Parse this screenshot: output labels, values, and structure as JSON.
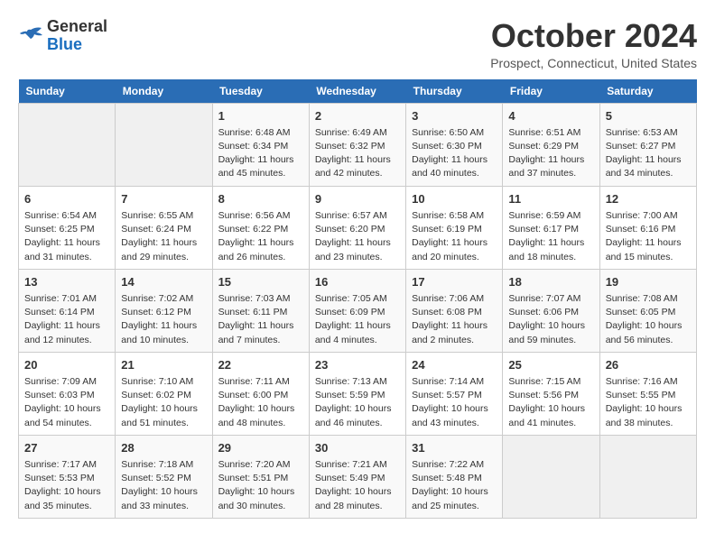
{
  "header": {
    "logo_line1": "General",
    "logo_line2": "Blue",
    "month": "October 2024",
    "location": "Prospect, Connecticut, United States"
  },
  "weekdays": [
    "Sunday",
    "Monday",
    "Tuesday",
    "Wednesday",
    "Thursday",
    "Friday",
    "Saturday"
  ],
  "weeks": [
    [
      {
        "num": "",
        "info": ""
      },
      {
        "num": "",
        "info": ""
      },
      {
        "num": "1",
        "info": "Sunrise: 6:48 AM\nSunset: 6:34 PM\nDaylight: 11 hours and 45 minutes."
      },
      {
        "num": "2",
        "info": "Sunrise: 6:49 AM\nSunset: 6:32 PM\nDaylight: 11 hours and 42 minutes."
      },
      {
        "num": "3",
        "info": "Sunrise: 6:50 AM\nSunset: 6:30 PM\nDaylight: 11 hours and 40 minutes."
      },
      {
        "num": "4",
        "info": "Sunrise: 6:51 AM\nSunset: 6:29 PM\nDaylight: 11 hours and 37 minutes."
      },
      {
        "num": "5",
        "info": "Sunrise: 6:53 AM\nSunset: 6:27 PM\nDaylight: 11 hours and 34 minutes."
      }
    ],
    [
      {
        "num": "6",
        "info": "Sunrise: 6:54 AM\nSunset: 6:25 PM\nDaylight: 11 hours and 31 minutes."
      },
      {
        "num": "7",
        "info": "Sunrise: 6:55 AM\nSunset: 6:24 PM\nDaylight: 11 hours and 29 minutes."
      },
      {
        "num": "8",
        "info": "Sunrise: 6:56 AM\nSunset: 6:22 PM\nDaylight: 11 hours and 26 minutes."
      },
      {
        "num": "9",
        "info": "Sunrise: 6:57 AM\nSunset: 6:20 PM\nDaylight: 11 hours and 23 minutes."
      },
      {
        "num": "10",
        "info": "Sunrise: 6:58 AM\nSunset: 6:19 PM\nDaylight: 11 hours and 20 minutes."
      },
      {
        "num": "11",
        "info": "Sunrise: 6:59 AM\nSunset: 6:17 PM\nDaylight: 11 hours and 18 minutes."
      },
      {
        "num": "12",
        "info": "Sunrise: 7:00 AM\nSunset: 6:16 PM\nDaylight: 11 hours and 15 minutes."
      }
    ],
    [
      {
        "num": "13",
        "info": "Sunrise: 7:01 AM\nSunset: 6:14 PM\nDaylight: 11 hours and 12 minutes."
      },
      {
        "num": "14",
        "info": "Sunrise: 7:02 AM\nSunset: 6:12 PM\nDaylight: 11 hours and 10 minutes."
      },
      {
        "num": "15",
        "info": "Sunrise: 7:03 AM\nSunset: 6:11 PM\nDaylight: 11 hours and 7 minutes."
      },
      {
        "num": "16",
        "info": "Sunrise: 7:05 AM\nSunset: 6:09 PM\nDaylight: 11 hours and 4 minutes."
      },
      {
        "num": "17",
        "info": "Sunrise: 7:06 AM\nSunset: 6:08 PM\nDaylight: 11 hours and 2 minutes."
      },
      {
        "num": "18",
        "info": "Sunrise: 7:07 AM\nSunset: 6:06 PM\nDaylight: 10 hours and 59 minutes."
      },
      {
        "num": "19",
        "info": "Sunrise: 7:08 AM\nSunset: 6:05 PM\nDaylight: 10 hours and 56 minutes."
      }
    ],
    [
      {
        "num": "20",
        "info": "Sunrise: 7:09 AM\nSunset: 6:03 PM\nDaylight: 10 hours and 54 minutes."
      },
      {
        "num": "21",
        "info": "Sunrise: 7:10 AM\nSunset: 6:02 PM\nDaylight: 10 hours and 51 minutes."
      },
      {
        "num": "22",
        "info": "Sunrise: 7:11 AM\nSunset: 6:00 PM\nDaylight: 10 hours and 48 minutes."
      },
      {
        "num": "23",
        "info": "Sunrise: 7:13 AM\nSunset: 5:59 PM\nDaylight: 10 hours and 46 minutes."
      },
      {
        "num": "24",
        "info": "Sunrise: 7:14 AM\nSunset: 5:57 PM\nDaylight: 10 hours and 43 minutes."
      },
      {
        "num": "25",
        "info": "Sunrise: 7:15 AM\nSunset: 5:56 PM\nDaylight: 10 hours and 41 minutes."
      },
      {
        "num": "26",
        "info": "Sunrise: 7:16 AM\nSunset: 5:55 PM\nDaylight: 10 hours and 38 minutes."
      }
    ],
    [
      {
        "num": "27",
        "info": "Sunrise: 7:17 AM\nSunset: 5:53 PM\nDaylight: 10 hours and 35 minutes."
      },
      {
        "num": "28",
        "info": "Sunrise: 7:18 AM\nSunset: 5:52 PM\nDaylight: 10 hours and 33 minutes."
      },
      {
        "num": "29",
        "info": "Sunrise: 7:20 AM\nSunset: 5:51 PM\nDaylight: 10 hours and 30 minutes."
      },
      {
        "num": "30",
        "info": "Sunrise: 7:21 AM\nSunset: 5:49 PM\nDaylight: 10 hours and 28 minutes."
      },
      {
        "num": "31",
        "info": "Sunrise: 7:22 AM\nSunset: 5:48 PM\nDaylight: 10 hours and 25 minutes."
      },
      {
        "num": "",
        "info": ""
      },
      {
        "num": "",
        "info": ""
      }
    ]
  ]
}
